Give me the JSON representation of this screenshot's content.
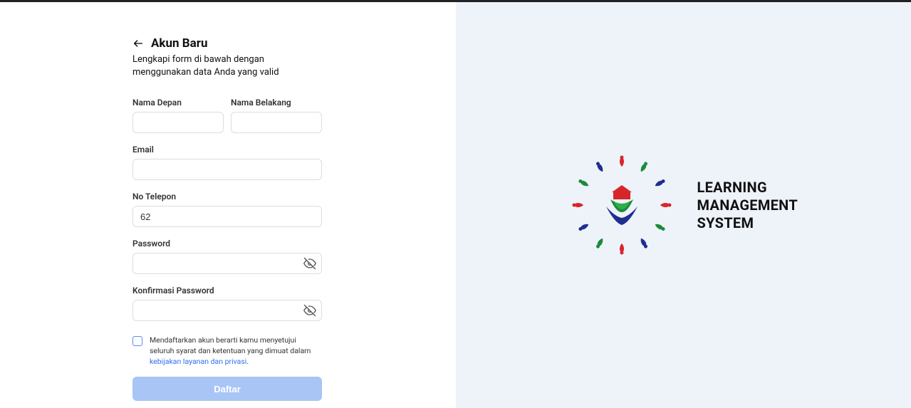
{
  "header": {
    "title": "Akun Baru",
    "subtitle": "Lengkapi form di bawah dengan menggunakan data Anda yang valid"
  },
  "form": {
    "first_name": {
      "label": "Nama Depan",
      "value": ""
    },
    "last_name": {
      "label": "Nama Belakang",
      "value": ""
    },
    "email": {
      "label": "Email",
      "value": ""
    },
    "phone": {
      "label": "No Telepon",
      "value": "62"
    },
    "password": {
      "label": "Password",
      "value": ""
    },
    "confirm": {
      "label": "Konfirmasi Password",
      "value": ""
    },
    "consent": {
      "checked": false,
      "text_before": "Mendaftarkan akun berarti kamu menyetujui seluruh syarat dan ketentuan yang dimuat dalam ",
      "link_text": "kebijakan layanan dan privasi",
      "text_after": "."
    },
    "submit_label": "Daftar"
  },
  "brand": {
    "line1": "LEARNING",
    "line2": "MANAGEMENT",
    "line3": "SYSTEM"
  }
}
